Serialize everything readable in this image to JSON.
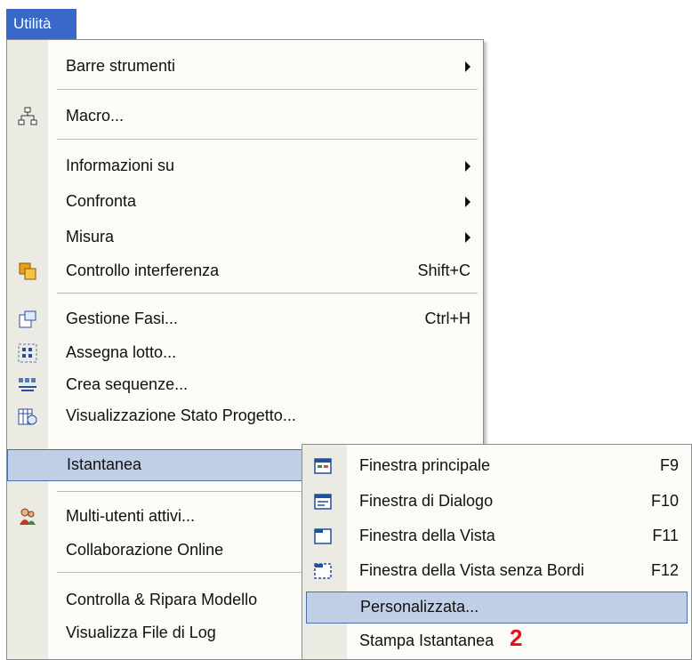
{
  "menubar": {
    "active_menu": "Utilità"
  },
  "main_menu": {
    "items": [
      {
        "label": "Barre strumenti",
        "submenu": true
      },
      {
        "label": "Macro...",
        "icon": "macro-icon"
      },
      {
        "label": "Informazioni su",
        "submenu": true
      },
      {
        "label": "Confronta",
        "submenu": true
      },
      {
        "label": "Misura",
        "submenu": true
      },
      {
        "label": "Controllo interferenza",
        "shortcut": "Shift+C",
        "icon": "interference-icon"
      },
      {
        "label": "Gestione Fasi...",
        "shortcut": "Ctrl+H",
        "icon": "phases-icon"
      },
      {
        "label": "Assegna lotto...",
        "icon": "lot-icon"
      },
      {
        "label": "Crea sequenze...",
        "icon": "sequence-icon"
      },
      {
        "label": "Visualizzazione Stato Progetto...",
        "icon": "project-status-icon"
      },
      {
        "label": "Istantanea",
        "highlighted": true
      },
      {
        "label": "Multi-utenti attivi...",
        "icon": "users-icon"
      },
      {
        "label": "Collaborazione Online"
      },
      {
        "label": "Controlla & Ripara Modello"
      },
      {
        "label": "Visualizza File di Log"
      }
    ]
  },
  "sub_menu": {
    "items": [
      {
        "label": "Finestra principale",
        "shortcut": "F9",
        "icon": "main-window-icon"
      },
      {
        "label": "Finestra di Dialogo",
        "shortcut": "F10",
        "icon": "dialog-window-icon"
      },
      {
        "label": "Finestra della Vista",
        "shortcut": "F11",
        "icon": "view-window-icon"
      },
      {
        "label": "Finestra della Vista senza Bordi",
        "shortcut": "F12",
        "icon": "borderless-view-icon"
      },
      {
        "label": "Personalizzata...",
        "highlighted": true
      },
      {
        "label": "Stampa Istantanea"
      }
    ]
  },
  "annotation": {
    "callout_number": "2",
    "color": "#e4101c"
  },
  "colors": {
    "menubar_active": "#3a68c8",
    "highlight_fill": "#c1cfe6",
    "highlight_border": "#4a6fb0",
    "gutter": "#ecebe3"
  }
}
